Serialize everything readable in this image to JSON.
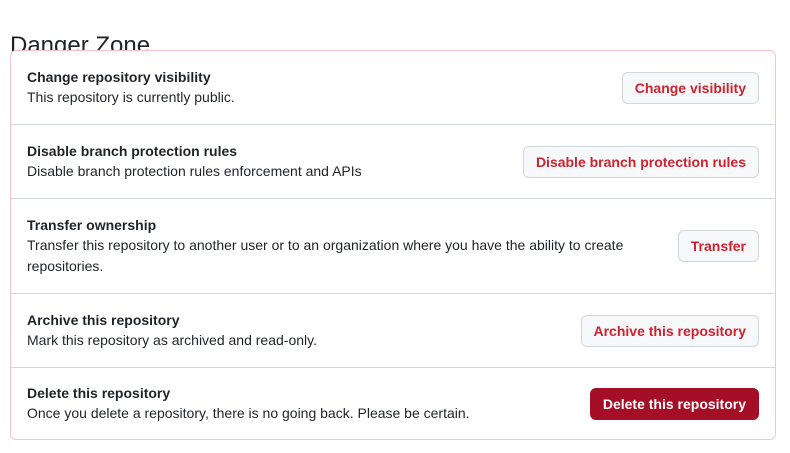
{
  "page": {
    "title": "Danger Zone"
  },
  "danger_zone": {
    "items": [
      {
        "title": "Change repository visibility",
        "description": "This repository is currently public.",
        "button": "Change visibility"
      },
      {
        "title": "Disable branch protection rules",
        "description": "Disable branch protection rules enforcement and APIs",
        "button": "Disable branch protection rules"
      },
      {
        "title": "Transfer ownership",
        "description": "Transfer this repository to another user or to an organization where you have the ability to create repositories.",
        "button": "Transfer"
      },
      {
        "title": "Archive this repository",
        "description": "Mark this repository as archived and read-only.",
        "button": "Archive this repository"
      },
      {
        "title": "Delete this repository",
        "description": "Once you delete a repository, there is no going back. Please be certain.",
        "button": "Delete this repository"
      }
    ]
  },
  "colors": {
    "danger_text": "#cf222e",
    "danger_button_bg": "#a40e26",
    "panel_border": "#f3c5cb",
    "divider": "#d0d7de"
  }
}
